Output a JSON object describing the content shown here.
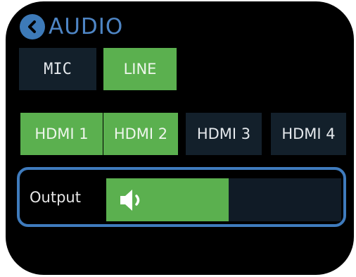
{
  "header": {
    "title": "AUDIO",
    "back_icon": "chevron-left-icon"
  },
  "input_mode": {
    "options": [
      {
        "label": "MIC",
        "selected": false
      },
      {
        "label": "LINE",
        "selected": true
      }
    ]
  },
  "hdmi_sources": [
    {
      "label": "HDMI 1",
      "selected": true
    },
    {
      "label": "HDMI 2",
      "selected": true
    },
    {
      "label": "HDMI 3",
      "selected": false
    },
    {
      "label": "HDMI 4",
      "selected": false
    }
  ],
  "output": {
    "label": "Output",
    "volume_level": 0.52,
    "icon": "speaker-icon"
  },
  "colors": {
    "selected": "#5bb04f",
    "unselected": "#13202b",
    "accent": "#3f7bbd",
    "background": "#000000"
  }
}
